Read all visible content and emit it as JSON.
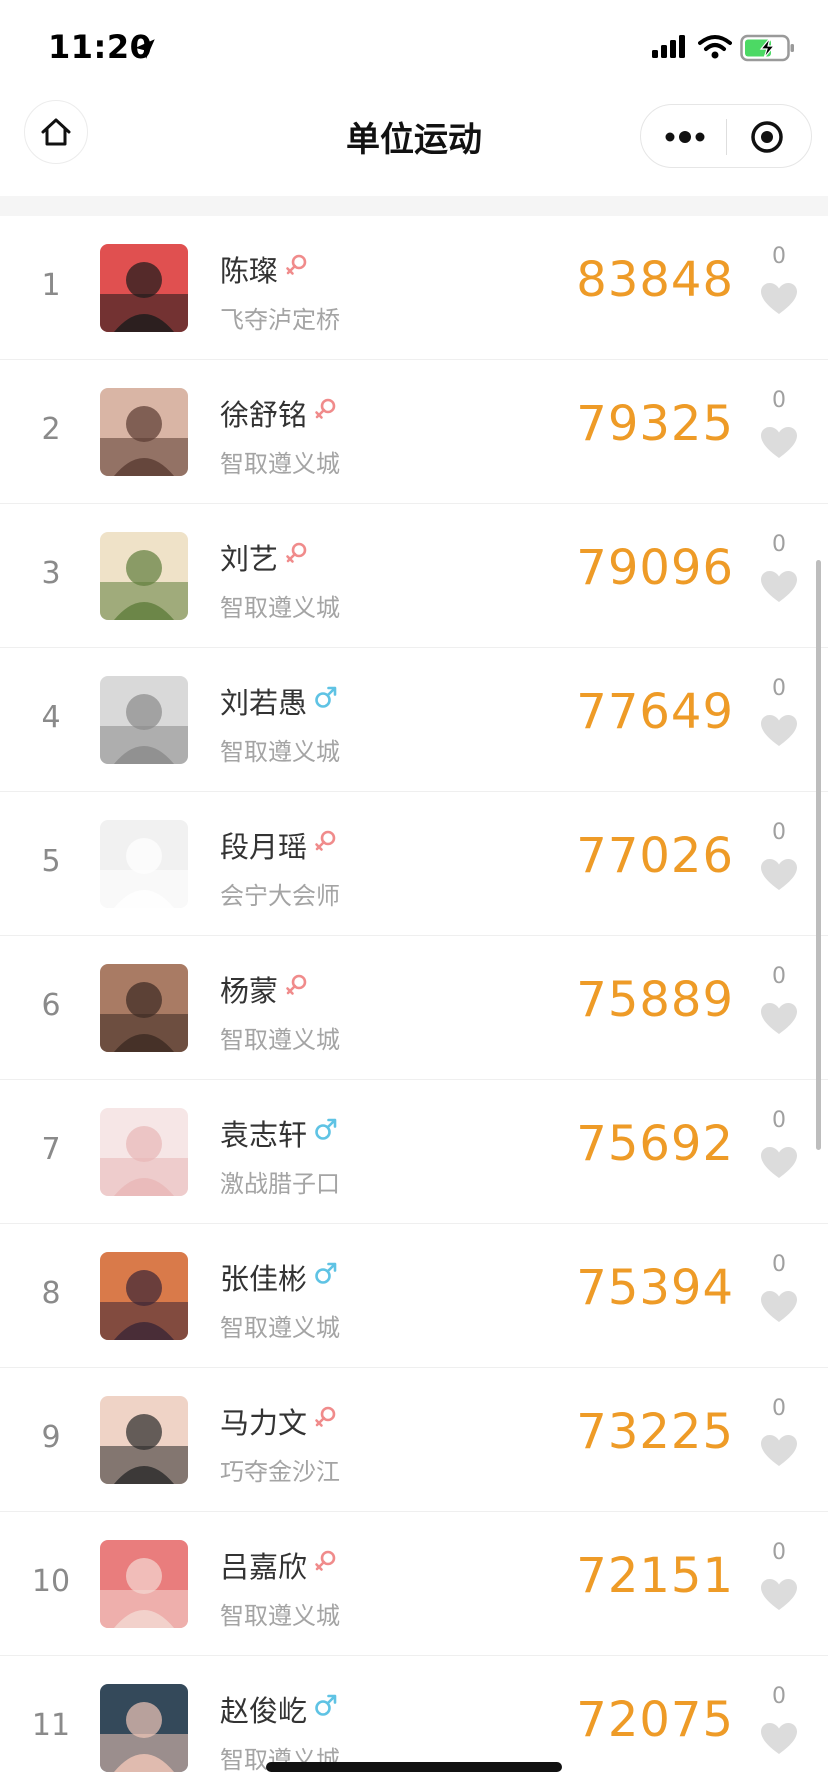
{
  "status_bar": {
    "time": "11:20"
  },
  "nav": {
    "title": "单位运动"
  },
  "colors": {
    "score": "#ee9b27",
    "female": "#f08b8b",
    "male": "#5fc3e4",
    "muted": "#a4a4a4"
  },
  "rows": [
    {
      "rank": "1",
      "name": "陈璨",
      "gender": "female",
      "team": "飞夺泸定桥",
      "steps": "83848",
      "likes": "0",
      "avatar_colors": [
        "#1a1a1a",
        "#e05050"
      ]
    },
    {
      "rank": "2",
      "name": "徐舒铭",
      "gender": "female",
      "team": "智取遵义城",
      "steps": "79325",
      "likes": "0",
      "avatar_colors": [
        "#5a3b32",
        "#d9b5a5"
      ]
    },
    {
      "rank": "3",
      "name": "刘艺",
      "gender": "female",
      "team": "智取遵义城",
      "steps": "79096",
      "likes": "0",
      "avatar_colors": [
        "#5f7d3c",
        "#efe2c8"
      ]
    },
    {
      "rank": "4",
      "name": "刘若愚",
      "gender": "male",
      "team": "智取遵义城",
      "steps": "77649",
      "likes": "0",
      "avatar_colors": [
        "#8a8a8a",
        "#d9d9d9"
      ]
    },
    {
      "rank": "5",
      "name": "段月瑶",
      "gender": "female",
      "team": "会宁大会师",
      "steps": "77026",
      "likes": "0",
      "avatar_colors": [
        "#ffffff",
        "#f1f1f1"
      ]
    },
    {
      "rank": "6",
      "name": "杨蒙",
      "gender": "female",
      "team": "智取遵义城",
      "steps": "75889",
      "likes": "0",
      "avatar_colors": [
        "#3c2a22",
        "#a97b64"
      ]
    },
    {
      "rank": "7",
      "name": "袁志轩",
      "gender": "male",
      "team": "激战腊子口",
      "steps": "75692",
      "likes": "0",
      "avatar_colors": [
        "#e8b7b7",
        "#f6e6e6"
      ]
    },
    {
      "rank": "8",
      "name": "张佳彬",
      "gender": "male",
      "team": "智取遵义城",
      "steps": "75394",
      "likes": "0",
      "avatar_colors": [
        "#3b2536",
        "#d97a4a"
      ]
    },
    {
      "rank": "9",
      "name": "马力文",
      "gender": "female",
      "team": "巧夺金沙江",
      "steps": "73225",
      "likes": "0",
      "avatar_colors": [
        "#2a2a2a",
        "#efd3c6"
      ]
    },
    {
      "rank": "10",
      "name": "吕嘉欣",
      "gender": "female",
      "team": "智取遵义城",
      "steps": "72151",
      "likes": "0",
      "avatar_colors": [
        "#f3d9d3",
        "#e97d7d"
      ]
    },
    {
      "rank": "11",
      "name": "赵俊屹",
      "gender": "male",
      "team": "智取遵义城",
      "steps": "72075",
      "likes": "0",
      "avatar_colors": [
        "#f1c7b8",
        "#34495a"
      ]
    }
  ]
}
